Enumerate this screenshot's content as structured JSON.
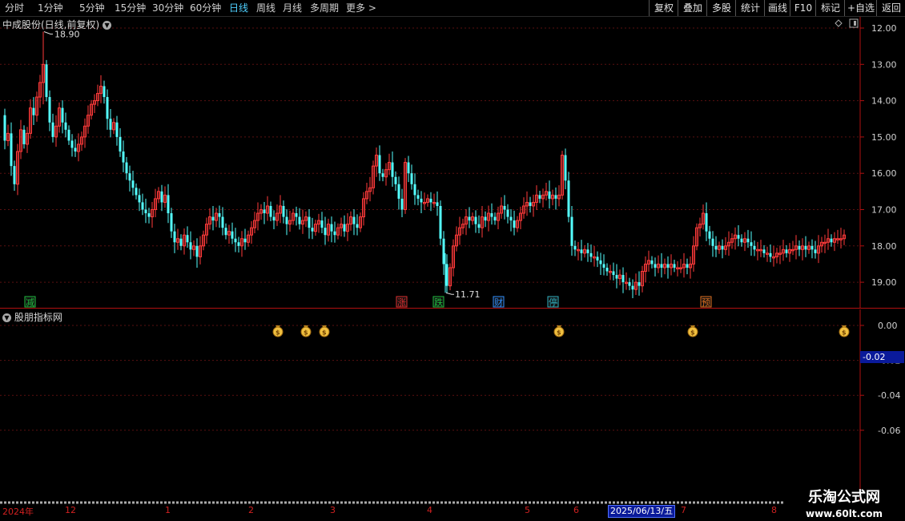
{
  "toolbar": {
    "periods": [
      {
        "label": "分时",
        "active": false
      },
      {
        "label": "1分钟",
        "active": false
      },
      {
        "label": "5分钟",
        "active": false
      },
      {
        "label": "15分钟",
        "active": false
      },
      {
        "label": "30分钟",
        "active": false
      },
      {
        "label": "60分钟",
        "active": false
      },
      {
        "label": "日线",
        "active": true
      },
      {
        "label": "周线",
        "active": false
      },
      {
        "label": "月线",
        "active": false
      },
      {
        "label": "多周期",
        "active": false
      },
      {
        "label": "更多",
        "active": false
      }
    ],
    "more_chevron": ">",
    "right_buttons": [
      "复权",
      "叠加",
      "多股",
      "统计",
      "画线",
      "F10",
      "标记",
      "+自选",
      "返回"
    ]
  },
  "main": {
    "title": "中成股份(日线,前复权)",
    "high_label": "18.90",
    "low_label": "11.71",
    "y_ticks": [
      "19.00",
      "18.00",
      "17.00",
      "16.00",
      "15.00",
      "14.00",
      "13.00",
      "12.00"
    ],
    "events": [
      {
        "text": "减",
        "color": "#20c040"
      },
      {
        "text": "涨",
        "color": "#e03030"
      },
      {
        "text": "跌",
        "color": "#20c040"
      },
      {
        "text": "财",
        "color": "#3090ff"
      },
      {
        "text": "停",
        "color": "#30b0c0"
      },
      {
        "text": "预",
        "color": "#e07020"
      }
    ],
    "colors": {
      "up": "#ff3a3a",
      "down": "#54ffff",
      "grid": "#5a1010",
      "axis": "#b01010"
    }
  },
  "sub": {
    "title": "股朋指标网",
    "y_ticks": [
      "0.00",
      "-0.02",
      "-0.04",
      "-0.06"
    ],
    "cursor_value": "-0.02",
    "signal_icon": "money-bag-icon"
  },
  "date_axis": {
    "labels": [
      "2024年",
      "12",
      "1",
      "2",
      "3",
      "4",
      "5",
      "6",
      "7",
      "8"
    ],
    "cursor_date": "2025/06/13/五"
  },
  "watermark": {
    "line1": "乐淘公式网",
    "line2": "www.60lt.com"
  },
  "chart_data": {
    "type": "candlestick",
    "title": "中成股份(日线,前复权)",
    "ylim": [
      11.5,
      19.2
    ],
    "y_ticks": [
      12,
      13,
      14,
      15,
      16,
      17,
      18,
      19
    ],
    "marked_high": 18.9,
    "marked_low": 11.71,
    "close_path": [
      [
        0,
        16.6
      ],
      [
        4,
        15.9
      ],
      [
        8,
        16.1
      ],
      [
        12,
        15.2
      ],
      [
        16,
        14.7
      ],
      [
        20,
        15.6
      ],
      [
        24,
        16.2
      ],
      [
        28,
        15.8
      ],
      [
        32,
        16.1
      ],
      [
        36,
        16.8
      ],
      [
        40,
        16.6
      ],
      [
        44,
        17.1
      ],
      [
        48,
        17.5
      ],
      [
        52,
        18.0
      ],
      [
        56,
        17.1
      ],
      [
        60,
        16.4
      ],
      [
        64,
        16.0
      ],
      [
        68,
        16.3
      ],
      [
        72,
        16.8
      ],
      [
        76,
        16.4
      ],
      [
        80,
        16.2
      ],
      [
        84,
        15.9
      ],
      [
        88,
        15.7
      ],
      [
        92,
        15.6
      ],
      [
        96,
        15.8
      ],
      [
        100,
        16.0
      ],
      [
        104,
        16.3
      ],
      [
        108,
        16.6
      ],
      [
        112,
        16.9
      ],
      [
        116,
        17.0
      ],
      [
        120,
        17.2
      ],
      [
        124,
        17.4
      ],
      [
        128,
        17.1
      ],
      [
        132,
        16.5
      ],
      [
        136,
        16.2
      ],
      [
        140,
        16.4
      ],
      [
        144,
        16.0
      ],
      [
        148,
        15.6
      ],
      [
        152,
        15.3
      ],
      [
        156,
        15.0
      ],
      [
        160,
        14.8
      ],
      [
        164,
        14.6
      ],
      [
        168,
        14.4
      ],
      [
        172,
        14.2
      ],
      [
        176,
        14.0
      ],
      [
        180,
        13.9
      ],
      [
        184,
        13.8
      ],
      [
        188,
        14.0
      ],
      [
        192,
        14.3
      ],
      [
        196,
        14.5
      ],
      [
        200,
        14.2
      ],
      [
        204,
        14.4
      ],
      [
        208,
        13.9
      ],
      [
        212,
        13.4
      ],
      [
        216,
        13.1
      ],
      [
        220,
        13.2
      ],
      [
        224,
        13.0
      ],
      [
        228,
        13.3
      ],
      [
        232,
        13.1
      ],
      [
        236,
        12.9
      ],
      [
        240,
        13.0
      ],
      [
        244,
        12.7
      ],
      [
        248,
        13.0
      ],
      [
        252,
        13.3
      ],
      [
        256,
        13.6
      ],
      [
        260,
        13.8
      ],
      [
        264,
        13.7
      ],
      [
        268,
        13.9
      ],
      [
        272,
        13.8
      ],
      [
        276,
        13.5
      ],
      [
        280,
        13.3
      ],
      [
        284,
        13.4
      ],
      [
        288,
        13.2
      ],
      [
        292,
        13.1
      ],
      [
        296,
        13.0
      ],
      [
        300,
        13.2
      ],
      [
        304,
        13.1
      ],
      [
        308,
        13.3
      ],
      [
        312,
        13.5
      ],
      [
        316,
        13.7
      ],
      [
        320,
        13.9
      ],
      [
        324,
        14.0
      ],
      [
        328,
        13.9
      ],
      [
        332,
        14.1
      ],
      [
        336,
        13.8
      ],
      [
        340,
        13.7
      ],
      [
        344,
        13.9
      ],
      [
        348,
        14.1
      ],
      [
        352,
        13.8
      ],
      [
        356,
        13.6
      ],
      [
        360,
        13.7
      ],
      [
        364,
        13.9
      ],
      [
        368,
        13.8
      ],
      [
        372,
        13.6
      ],
      [
        376,
        13.7
      ],
      [
        380,
        13.8
      ],
      [
        384,
        13.5
      ],
      [
        388,
        13.4
      ],
      [
        392,
        13.6
      ],
      [
        396,
        13.7
      ],
      [
        400,
        13.5
      ],
      [
        404,
        13.3
      ],
      [
        408,
        13.6
      ],
      [
        412,
        13.4
      ],
      [
        416,
        13.3
      ],
      [
        420,
        13.5
      ],
      [
        424,
        13.6
      ],
      [
        428,
        13.4
      ],
      [
        432,
        13.6
      ],
      [
        436,
        13.8
      ],
      [
        440,
        13.6
      ],
      [
        444,
        13.5
      ],
      [
        448,
        13.8
      ],
      [
        452,
        14.3
      ],
      [
        456,
        14.5
      ],
      [
        460,
        14.6
      ],
      [
        464,
        15.2
      ],
      [
        468,
        15.5
      ],
      [
        472,
        15.0
      ],
      [
        476,
        14.9
      ],
      [
        480,
        15.1
      ],
      [
        484,
        15.3
      ],
      [
        488,
        14.9
      ],
      [
        492,
        14.7
      ],
      [
        496,
        14.3
      ],
      [
        500,
        14.0
      ],
      [
        504,
        15.3
      ],
      [
        508,
        15.0
      ],
      [
        512,
        14.7
      ],
      [
        516,
        14.4
      ],
      [
        520,
        14.3
      ],
      [
        524,
        14.2
      ],
      [
        528,
        14.2
      ],
      [
        532,
        14.3
      ],
      [
        536,
        14.2
      ],
      [
        540,
        14.2
      ],
      [
        544,
        14.1
      ],
      [
        548,
        13.2
      ],
      [
        552,
        12.5
      ],
      [
        556,
        11.9
      ],
      [
        560,
        12.4
      ],
      [
        564,
        13.0
      ],
      [
        568,
        13.3
      ],
      [
        572,
        13.5
      ],
      [
        576,
        13.6
      ],
      [
        580,
        13.8
      ],
      [
        584,
        13.7
      ],
      [
        588,
        13.8
      ],
      [
        592,
        13.6
      ],
      [
        596,
        13.5
      ],
      [
        600,
        13.8
      ],
      [
        604,
        13.7
      ],
      [
        608,
        13.9
      ],
      [
        612,
        13.8
      ],
      [
        616,
        13.7
      ],
      [
        620,
        13.9
      ],
      [
        624,
        14.1
      ],
      [
        628,
        14.0
      ],
      [
        632,
        13.8
      ],
      [
        636,
        13.7
      ],
      [
        640,
        13.5
      ],
      [
        644,
        13.7
      ],
      [
        648,
        13.9
      ],
      [
        652,
        14.1
      ],
      [
        656,
        14.2
      ],
      [
        660,
        14.1
      ],
      [
        664,
        14.2
      ],
      [
        668,
        14.4
      ],
      [
        672,
        14.3
      ],
      [
        676,
        14.4
      ],
      [
        680,
        14.5
      ],
      [
        684,
        14.3
      ],
      [
        688,
        14.4
      ],
      [
        692,
        14.3
      ],
      [
        696,
        14.4
      ],
      [
        700,
        15.5
      ],
      [
        704,
        14.8
      ],
      [
        708,
        13.8
      ],
      [
        712,
        13.0
      ],
      [
        716,
        12.9
      ],
      [
        720,
        12.9
      ],
      [
        724,
        12.8
      ],
      [
        728,
        12.9
      ],
      [
        732,
        12.8
      ],
      [
        736,
        12.7
      ],
      [
        740,
        12.7
      ],
      [
        744,
        12.6
      ],
      [
        748,
        12.5
      ],
      [
        752,
        12.4
      ],
      [
        756,
        12.3
      ],
      [
        760,
        12.3
      ],
      [
        764,
        12.2
      ],
      [
        768,
        12.1
      ],
      [
        772,
        12.2
      ],
      [
        776,
        12.0
      ],
      [
        780,
        12.0
      ],
      [
        784,
        11.9
      ],
      [
        788,
        11.8
      ],
      [
        792,
        12.0
      ],
      [
        796,
        11.9
      ],
      [
        800,
        12.3
      ],
      [
        804,
        12.5
      ],
      [
        808,
        12.6
      ],
      [
        812,
        12.5
      ],
      [
        816,
        12.4
      ],
      [
        820,
        12.5
      ],
      [
        824,
        12.4
      ],
      [
        828,
        12.5
      ],
      [
        832,
        12.4
      ],
      [
        836,
        12.5
      ],
      [
        840,
        12.4
      ],
      [
        844,
        12.4
      ],
      [
        848,
        12.4
      ],
      [
        852,
        12.5
      ],
      [
        856,
        12.4
      ],
      [
        860,
        12.5
      ],
      [
        864,
        13.0
      ],
      [
        868,
        13.5
      ],
      [
        872,
        13.6
      ],
      [
        876,
        13.9
      ],
      [
        880,
        13.4
      ],
      [
        884,
        13.2
      ],
      [
        888,
        13.0
      ],
      [
        892,
        12.9
      ],
      [
        896,
        13.0
      ],
      [
        900,
        12.9
      ],
      [
        904,
        13.0
      ],
      [
        908,
        13.1
      ],
      [
        912,
        13.2
      ],
      [
        916,
        13.3
      ],
      [
        920,
        13.2
      ],
      [
        924,
        13.1
      ],
      [
        928,
        13.2
      ],
      [
        932,
        13.1
      ],
      [
        936,
        13.0
      ],
      [
        940,
        12.9
      ],
      [
        944,
        12.9
      ],
      [
        948,
        12.9
      ],
      [
        952,
        12.8
      ],
      [
        956,
        12.8
      ],
      [
        960,
        12.7
      ],
      [
        964,
        12.7
      ],
      [
        968,
        12.8
      ],
      [
        972,
        12.8
      ],
      [
        976,
        12.9
      ],
      [
        980,
        12.8
      ],
      [
        984,
        12.9
      ],
      [
        988,
        12.9
      ],
      [
        992,
        13.0
      ],
      [
        996,
        12.9
      ],
      [
        1000,
        13.0
      ],
      [
        1004,
        12.9
      ],
      [
        1008,
        13.0
      ],
      [
        1012,
        12.9
      ],
      [
        1016,
        12.8
      ],
      [
        1020,
        13.0
      ],
      [
        1024,
        13.1
      ],
      [
        1028,
        13.1
      ],
      [
        1032,
        13.2
      ],
      [
        1036,
        13.1
      ],
      [
        1040,
        13.2
      ],
      [
        1044,
        13.2
      ],
      [
        1048,
        13.2
      ],
      [
        1052,
        13.3
      ]
    ]
  }
}
